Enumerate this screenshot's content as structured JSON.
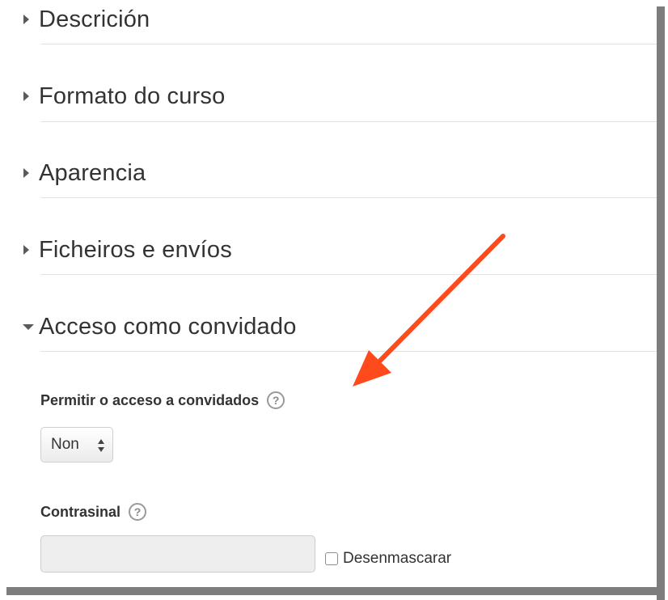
{
  "sections": [
    {
      "title": "Descrición",
      "expanded": false
    },
    {
      "title": "Formato do curso",
      "expanded": false
    },
    {
      "title": "Aparencia",
      "expanded": false
    },
    {
      "title": "Ficheiros e envíos",
      "expanded": false
    },
    {
      "title": "Acceso como convidado",
      "expanded": true
    }
  ],
  "guest_access": {
    "allow_label": "Permitir o acceso a convidados",
    "allow_value": "Non",
    "password_label": "Contrasinal",
    "password_value": "",
    "unmask_label": "Desenmascarar",
    "unmask_checked": false
  },
  "icons": {
    "collapsed": "triangle-right-icon",
    "expanded": "triangle-down-icon",
    "help": "question-circle-icon",
    "select": "updown-arrows-icon"
  },
  "colors": {
    "annotation_arrow": "#ff4a1c",
    "text": "#333333",
    "shadow": "#7d7d7d"
  }
}
